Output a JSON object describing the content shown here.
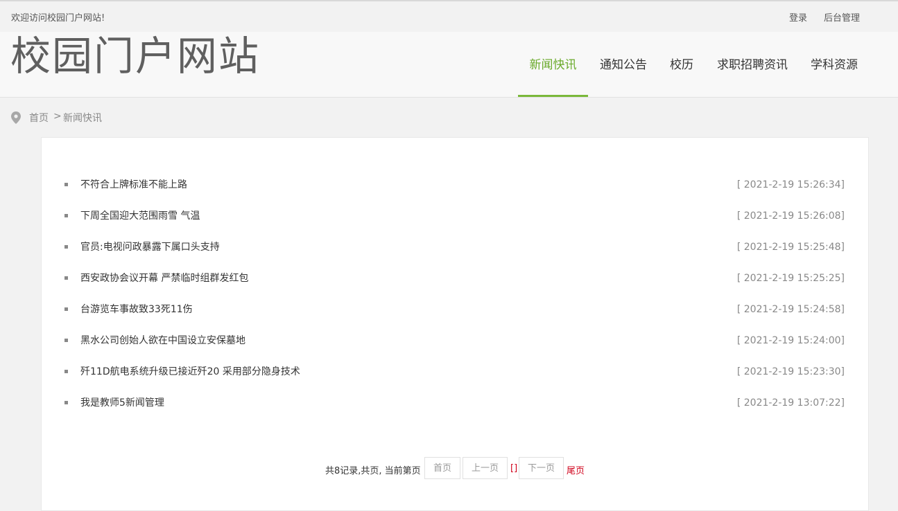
{
  "topbar": {
    "welcome": "欢迎访问校园门户网站!",
    "login": "登录",
    "admin": "后台管理"
  },
  "header": {
    "site_title": "校园门户网站",
    "nav": [
      {
        "label": "新闻快讯",
        "active": true
      },
      {
        "label": "通知公告",
        "active": false
      },
      {
        "label": "校历",
        "active": false
      },
      {
        "label": "求职招聘资讯",
        "active": false
      },
      {
        "label": "学科资源",
        "active": false
      }
    ],
    "accent_color": "#6aaa2b"
  },
  "breadcrumb": {
    "icon": "map-pin-icon",
    "home": "首页",
    "separator": ">",
    "current": "新闻快讯"
  },
  "news": [
    {
      "title": "不符合上牌标准不能上路",
      "date": "[ 2021-2-19 15:26:34]"
    },
    {
      "title": "下周全国迎大范围雨雪 气温",
      "date": "[ 2021-2-19 15:26:08]"
    },
    {
      "title": "官员:电视问政暴露下属口头支持",
      "date": "[ 2021-2-19 15:25:48]"
    },
    {
      "title": "西安政协会议开幕 严禁临时组群发红包",
      "date": "[ 2021-2-19 15:25:25]"
    },
    {
      "title": "台游览车事故致33死11伤",
      "date": "[ 2021-2-19 15:24:58]"
    },
    {
      "title": "黑水公司创始人欲在中国设立安保墓地",
      "date": "[ 2021-2-19 15:24:00]"
    },
    {
      "title": "歼11D航电系统升级已接近歼20 采用部分隐身技术",
      "date": "[ 2021-2-19 15:23:30]"
    },
    {
      "title": "我是教师5新闻管理",
      "date": "[ 2021-2-19 13:07:22]"
    }
  ],
  "pager": {
    "info": "共8记录,共页, 当前第页",
    "first": "首页",
    "prev": "上一页",
    "current": "[]",
    "next": "下一页",
    "last": "尾页"
  }
}
